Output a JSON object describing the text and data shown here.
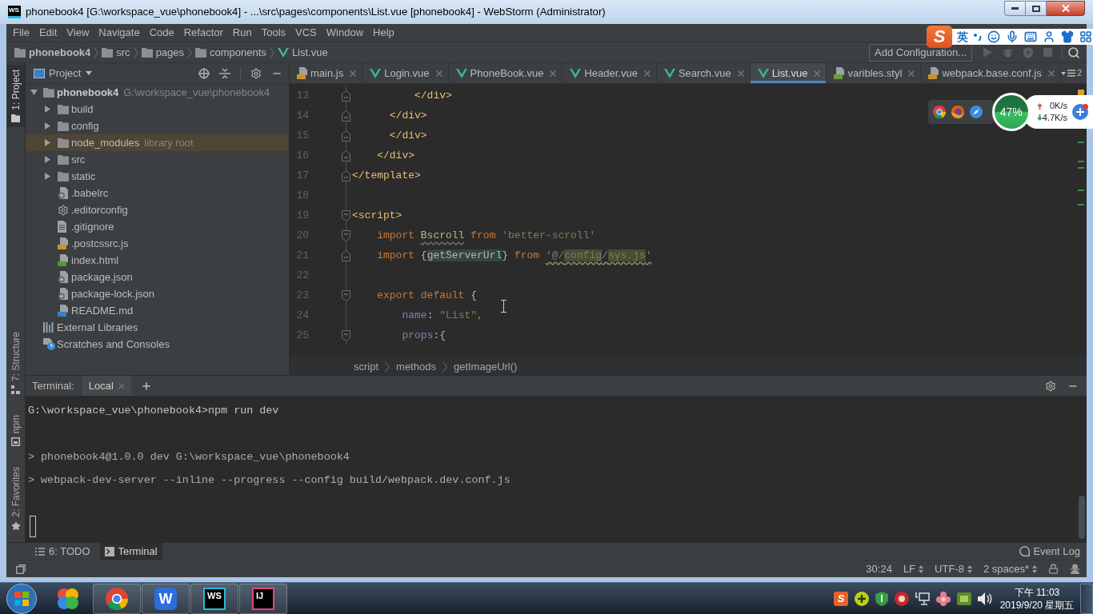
{
  "window": {
    "logo": "WS",
    "title": "phonebook4 [G:\\workspace_vue\\phonebook4] - ...\\src\\pages\\components\\List.vue [phonebook4] - WebStorm (Administrator)"
  },
  "menu": [
    "File",
    "Edit",
    "View",
    "Navigate",
    "Code",
    "Refactor",
    "Run",
    "Tools",
    "VCS",
    "Window",
    "Help"
  ],
  "navbar": {
    "path": [
      {
        "label": "phonebook4",
        "kind": "folder"
      },
      {
        "label": "src",
        "kind": "folder"
      },
      {
        "label": "pages",
        "kind": "folder"
      },
      {
        "label": "components",
        "kind": "folder"
      },
      {
        "label": "List.vue",
        "kind": "vue"
      }
    ],
    "run_config": "Add Configuration..."
  },
  "ime_toolbar": {
    "logo": "S",
    "mode": "英"
  },
  "side_tabs": [
    {
      "label": "1: Project",
      "kind": "project",
      "selected": true
    },
    {
      "label": "7: Structure",
      "kind": "structure",
      "selected": false
    },
    {
      "label": "npm",
      "kind": "npm",
      "selected": false
    },
    {
      "label": "2: Favorites",
      "kind": "favorites",
      "selected": false
    }
  ],
  "project": {
    "title": "Project",
    "tree": [
      {
        "label": "phonebook4",
        "hint": "G:\\workspace_vue\\phonebook4",
        "kind": "folder",
        "expanded": true,
        "selected": false,
        "children": [
          {
            "label": "build",
            "kind": "folder",
            "expanded": false,
            "selected": false
          },
          {
            "label": "config",
            "kind": "folder",
            "expanded": false,
            "selected": false
          },
          {
            "label": "node_modules",
            "hint": "library root",
            "kind": "folder",
            "expanded": false,
            "selected": true
          },
          {
            "label": "src",
            "kind": "folder",
            "expanded": false,
            "selected": false
          },
          {
            "label": "static",
            "kind": "folder",
            "expanded": false,
            "selected": false
          },
          {
            "label": ".babelrc",
            "kind": "config",
            "selected": false
          },
          {
            "label": ".editorconfig",
            "kind": "gear",
            "selected": false
          },
          {
            "label": ".gitignore",
            "kind": "text",
            "selected": false
          },
          {
            "label": ".postcssrc.js",
            "kind": "js",
            "selected": false
          },
          {
            "label": "index.html",
            "kind": "html",
            "selected": false
          },
          {
            "label": "package.json",
            "kind": "config",
            "selected": false
          },
          {
            "label": "package-lock.json",
            "kind": "config",
            "selected": false
          },
          {
            "label": "README.md",
            "kind": "md",
            "selected": false
          }
        ]
      },
      {
        "label": "External Libraries",
        "kind": "libraries",
        "selected": false
      },
      {
        "label": "Scratches and Consoles",
        "kind": "scratches",
        "selected": false
      }
    ]
  },
  "editor": {
    "tabs": [
      {
        "label": "main.js",
        "kind": "js",
        "selected": false
      },
      {
        "label": "Login.vue",
        "kind": "vue",
        "selected": false
      },
      {
        "label": "PhoneBook.vue",
        "kind": "vue",
        "selected": false
      },
      {
        "label": "Header.vue",
        "kind": "vue",
        "selected": false
      },
      {
        "label": "Search.vue",
        "kind": "vue",
        "selected": false
      },
      {
        "label": "List.vue",
        "kind": "vue",
        "selected": true
      },
      {
        "label": "varibles.styl",
        "kind": "styl",
        "selected": false
      },
      {
        "label": "webpack.base.conf.js",
        "kind": "js",
        "selected": false
      }
    ],
    "tab_overflow": "2",
    "lines": [
      {
        "number": "13",
        "kind": "fold-end",
        "tokens": [
          {
            "text": "          </div>",
            "kind": "tag"
          }
        ]
      },
      {
        "number": "14",
        "kind": "fold-end",
        "tokens": [
          {
            "text": "      </div>",
            "kind": "tag"
          }
        ]
      },
      {
        "number": "15",
        "kind": "fold-end",
        "tokens": [
          {
            "text": "      </div>",
            "kind": "tag"
          }
        ]
      },
      {
        "number": "16",
        "kind": "fold-end",
        "tokens": [
          {
            "text": "    </div>",
            "kind": "tag"
          }
        ]
      },
      {
        "number": "17",
        "kind": "fold-end",
        "tokens": [
          {
            "text": "</template>",
            "kind": "tag"
          }
        ]
      },
      {
        "number": "18",
        "kind": "plain"
      },
      {
        "number": "19",
        "kind": "fold-start",
        "tokens": [
          {
            "text": "<script>",
            "kind": "tag"
          }
        ]
      },
      {
        "number": "20",
        "kind": "fold-start",
        "tokens": [
          {
            "text": "    import ",
            "kind": "keyword"
          },
          {
            "text": "Bscroll",
            "kind": "unused"
          },
          {
            "text": " from ",
            "kind": "keyword"
          },
          {
            "text": "'better-scroll'",
            "kind": "string"
          }
        ]
      },
      {
        "number": "21",
        "kind": "fold-end",
        "tokens": [
          {
            "text": "    import ",
            "kind": "keyword"
          },
          {
            "text": "{",
            "kind": "plain"
          },
          {
            "text": "getServerUrl",
            "kind": "highlight"
          },
          {
            "text": "} ",
            "kind": "plain"
          },
          {
            "text": "from ",
            "kind": "keyword"
          },
          {
            "text": "'@/",
            "kind": "bad-path"
          },
          {
            "text": "config",
            "kind": "bad-path-match"
          },
          {
            "text": "/",
            "kind": "bad-path"
          },
          {
            "text": "sys.js",
            "kind": "bad-path-match"
          },
          {
            "text": "'",
            "kind": "bad-path"
          }
        ]
      },
      {
        "number": "22",
        "kind": "plain"
      },
      {
        "number": "23",
        "kind": "fold-start",
        "tokens": [
          {
            "text": "    export default ",
            "kind": "keyword"
          },
          {
            "text": "{",
            "kind": "plain"
          }
        ]
      },
      {
        "number": "24",
        "kind": "plain",
        "tokens": [
          {
            "text": "        name",
            "kind": "field"
          },
          {
            "text": ": ",
            "kind": "plain"
          },
          {
            "text": "\"List\"",
            "kind": "string"
          },
          {
            "text": ",",
            "kind": "keyword"
          }
        ]
      },
      {
        "number": "25",
        "kind": "fold-start",
        "tokens": [
          {
            "text": "        props",
            "kind": "field"
          },
          {
            "text": ":{",
            "kind": "plain"
          }
        ]
      }
    ],
    "breadcrumb": [
      "script",
      "methods",
      "getImageUrl()"
    ]
  },
  "net_monitor": {
    "usage": "47%",
    "upload": "0K/s",
    "download": "4.7K/s"
  },
  "terminal": {
    "title": "Terminal:",
    "tabs": [
      {
        "label": "Local",
        "selected": true
      }
    ],
    "lines": [
      {
        "kind": "command",
        "text": "G:\\workspace_vue\\phonebook4>npm run dev"
      },
      {
        "kind": "blank"
      },
      {
        "kind": "output",
        "text": "> phonebook4@1.0.0 dev G:\\workspace_vue\\phonebook4"
      },
      {
        "kind": "output",
        "text": "> webpack-dev-server --inline --progress --config build/webpack.dev.conf.js"
      },
      {
        "kind": "blank"
      },
      {
        "kind": "prompt"
      }
    ]
  },
  "tool_tabs": [
    {
      "label": "6: TODO",
      "kind": "todo",
      "selected": false
    },
    {
      "label": "Terminal",
      "kind": "terminal",
      "selected": true
    }
  ],
  "event_log": "Event Log",
  "status_bar": {
    "position": "30:24",
    "line_separator": "LF",
    "encoding": "UTF-8",
    "indent": "2 spaces*"
  },
  "taskbar": {
    "apps": [
      {
        "kind": "pinwheel",
        "running": false
      },
      {
        "kind": "chrome",
        "running": true
      },
      {
        "kind": "wps",
        "label": "W",
        "running": true
      },
      {
        "kind": "webstorm",
        "label": "WS",
        "running": true
      },
      {
        "kind": "intellij",
        "label": "IJ",
        "running": true
      }
    ],
    "tray_logo": "S",
    "time": "下午 11:03",
    "date": "2019/9/20 星期五"
  }
}
